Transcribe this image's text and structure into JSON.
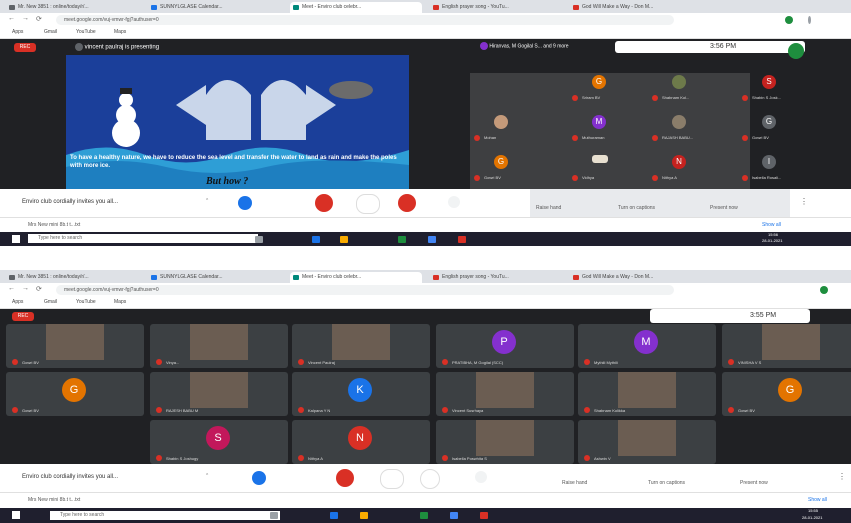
{
  "shot1": {
    "tabs": [
      "Mr. New 3851 : online/today/r/...",
      "SUNNYLGLASE Calendar...",
      "Meet - Enviro club celebr...",
      "English prayer song - YouTu...",
      "God Will Make a Way - Don M..."
    ],
    "url": "meet.google.com/vuj-vmwr-fgj?authuser=0",
    "bookmarks": [
      "Apps",
      "Gmail",
      "YouTube",
      "Maps"
    ],
    "rec": "REC",
    "presenting": "vincent paulraj is presenting",
    "top_names": "Hiranvas, M Gogilal S... and 9 more",
    "time": "3:56 PM",
    "slide_text": "To have a healthy nature, we have to reduce the sea level and transfer the water to land as rain and make the poles with more ice.",
    "slide_question": "But how ?",
    "participants": [
      {
        "name": "Sriram BV",
        "letter": "G",
        "color": "#e37400"
      },
      {
        "name": "Shabnam Kol...",
        "letter": "",
        "color": "#5f6368"
      },
      {
        "name": "Shabin S Josk...",
        "letter": "S",
        "color": "#c5221f"
      },
      {
        "name": "Mohan",
        "letter": "",
        "color": "#5f6368"
      },
      {
        "name": "Muthuraman",
        "letter": "M",
        "color": "#8430ce"
      },
      {
        "name": "RAJASH BABU...",
        "letter": "",
        "color": "#5f6368"
      },
      {
        "name": "Gowri BV",
        "letter": "G",
        "color": "#5f6368"
      },
      {
        "name": "Gowri BV",
        "letter": "G",
        "color": "#e37400"
      },
      {
        "name": "Vidhya",
        "letter": "",
        "color": "#5f6368"
      },
      {
        "name": "Nithya A",
        "letter": "N",
        "color": "#c5221f"
      },
      {
        "name": "Isabella Rosali...",
        "letter": "I",
        "color": "#5f6368"
      }
    ],
    "meeting_title": "Enviro club cordially invites you all...",
    "bottom_labels": [
      "Raise hand",
      "Turn on captions",
      "Present now"
    ],
    "download": "Mrs New mini 8b.t t...txt",
    "show_all": "Show all",
    "search": "Type here to search",
    "clock": "15:56",
    "date": "28-01-2021"
  },
  "shot2": {
    "tabs": [
      "Mr. New 3851 : online/today/r/...",
      "SUNNYLGLASE Calendar...",
      "Meet - Enviro club celebr...",
      "English prayer song - YouTu...",
      "God Will Make a Way - Don M..."
    ],
    "url": "meet.google.com/vuj-vmwr-fgj?authuser=0",
    "bookmarks": [
      "Apps",
      "Gmail",
      "YouTube",
      "Maps"
    ],
    "rec": "REC",
    "time": "3:55 PM",
    "participants": [
      {
        "name": "Gowri BV",
        "letter": "",
        "color": "#5f6368"
      },
      {
        "name": "Vinya...",
        "letter": "",
        "color": "#5f6368"
      },
      {
        "name": "Vincent Paulraj",
        "letter": "",
        "color": "#5f6368"
      },
      {
        "name": "PRATIBHA, M Gogilal (SCC)",
        "letter": "P",
        "color": "#8430ce"
      },
      {
        "name": "Mythili Mythili",
        "letter": "M",
        "color": "#8430ce"
      },
      {
        "name": "VINISHA V S",
        "letter": "",
        "color": "#5f6368"
      },
      {
        "name": "Gowri BV",
        "letter": "G",
        "color": "#e37400"
      },
      {
        "name": "RAJESH BABU M",
        "letter": "",
        "color": "#5f6368"
      },
      {
        "name": "Kalpana Y N",
        "letter": "K",
        "color": "#1a73e8"
      },
      {
        "name": "Vincent Susrhaya",
        "letter": "",
        "color": "#5f6368"
      },
      {
        "name": "Shabnam Kolikka",
        "letter": "",
        "color": "#5f6368"
      },
      {
        "name": "Gowri BV",
        "letter": "G",
        "color": "#e37400"
      },
      {
        "name": "Shabin S Joshugy",
        "letter": "S",
        "color": "#c2185b"
      },
      {
        "name": "Nithya A",
        "letter": "N",
        "color": "#d93025"
      },
      {
        "name": "Isabella Poswhita S",
        "letter": "",
        "color": "#5f6368"
      },
      {
        "name": "Ashwin V",
        "letter": "",
        "color": "#5f6368"
      }
    ],
    "meeting_title": "Enviro club cordially invites you all...",
    "bottom_labels": [
      "Raise hand",
      "Turn on captions",
      "Present now"
    ],
    "download": "Mrs New mini 8b.t t...txt",
    "show_all": "Show all",
    "search": "Type here to search",
    "clock": "15:55",
    "date": "28-01-2021"
  }
}
